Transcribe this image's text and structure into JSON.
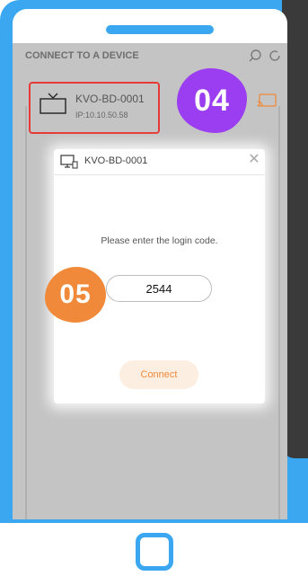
{
  "app": {
    "title": "CONNECT TO A DEVICE",
    "icons": {
      "search": "search-icon",
      "refresh": "refresh-icon",
      "cast": "cast-icon"
    }
  },
  "device": {
    "name": "KVO-BD-0001",
    "ip": "IP:10.10.50.58",
    "icon": "tv-icon"
  },
  "badges": {
    "step_04": "04",
    "step_05": "05"
  },
  "dialog": {
    "title": "KVO-BD-0001",
    "prompt": "Please enter the login code.",
    "code_value": "2544",
    "connect_label": "Connect"
  },
  "colors": {
    "phone_frame": "#3aa7f0",
    "badge_04": "#9b3df0",
    "badge_05": "#f08a3a",
    "selection_border": "#e53935",
    "connect_text": "#f08a3a"
  }
}
